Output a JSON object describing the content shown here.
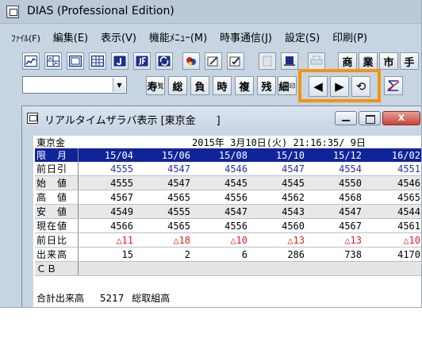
{
  "window": {
    "title": "DIAS (Professional Edition)"
  },
  "menu": [
    {
      "label": "ﾌｧｲﾙ(F)"
    },
    {
      "label": "編集(E)"
    },
    {
      "label": "表示(V)"
    },
    {
      "label": "機能ﾒﾆｭｰ(M)"
    },
    {
      "label": "時事通信(J)"
    },
    {
      "label": "設定(S)"
    },
    {
      "label": "印刷(P)"
    }
  ],
  "toolbar1": {
    "icons": [
      "chart-icon",
      "multi-chart-icon",
      "board-icon",
      "table-icon",
      "j-icon",
      "jf-icon",
      "refresh-icon",
      "color-icon",
      "edit-icon",
      "memo-icon",
      "gray-window-icon",
      "blue-window-icon",
      "print-icon"
    ],
    "text_buttons": [
      "商",
      "業",
      "市",
      "手"
    ]
  },
  "toolbar2": {
    "combo_value": "",
    "buttons": [
      {
        "label": "寿",
        "sub": "覧"
      },
      {
        "label": "総"
      },
      {
        "label": "負"
      },
      {
        "label": "時"
      },
      {
        "label": "複"
      },
      {
        "label": "残"
      },
      {
        "label": "細",
        "sub": "印"
      }
    ],
    "nav": {
      "prev": "◀",
      "next": "▶",
      "reload": "⟲"
    },
    "last_icon": "sum-icon"
  },
  "child": {
    "title": "リアルタイムザラバ表示 [東京金　　]",
    "close": "x",
    "market": "東京金",
    "datetime": "2015年 3月10日(火) 21:16:35/ 9日",
    "header_label": "限　月",
    "columns": [
      "15/04",
      "15/06",
      "15/08",
      "15/10",
      "15/12",
      "16/02"
    ],
    "rows": [
      {
        "label": "前日引",
        "values": [
          "4555",
          "4547",
          "4546",
          "4547",
          "4554",
          "4551"
        ],
        "style": "blue"
      },
      {
        "label": "始　値",
        "values": [
          "4555",
          "4547",
          "4545",
          "4545",
          "4550",
          "4546"
        ],
        "style": "alt"
      },
      {
        "label": "高　値",
        "values": [
          "4567",
          "4565",
          "4556",
          "4562",
          "4568",
          "4565"
        ],
        "style": "plain"
      },
      {
        "label": "安　値",
        "values": [
          "4549",
          "4555",
          "4547",
          "4543",
          "4547",
          "4544"
        ],
        "style": "alt"
      },
      {
        "label": "現在値",
        "values": [
          "4566",
          "4565",
          "4556",
          "4560",
          "4567",
          "4561"
        ],
        "style": "plain"
      },
      {
        "label": "前日比",
        "values": [
          "△11",
          "△18",
          "△10",
          "△13",
          "△13",
          "△10"
        ],
        "style": "red"
      },
      {
        "label": "出来高",
        "values": [
          "15",
          "2",
          "6",
          "286",
          "738",
          "4170"
        ],
        "style": "plain"
      },
      {
        "label": "ＣＢ",
        "values": [
          "",
          "",
          "",
          "",
          "",
          ""
        ],
        "style": "cb"
      }
    ],
    "footer": {
      "total_volume_label": "合計出来高",
      "total_volume": "5217",
      "open_interest_label": "総取組高"
    }
  },
  "colors": {
    "accent": "#f29312",
    "header_bg": "#10249a",
    "red": "#e61c1c",
    "blue": "#2330b8"
  }
}
